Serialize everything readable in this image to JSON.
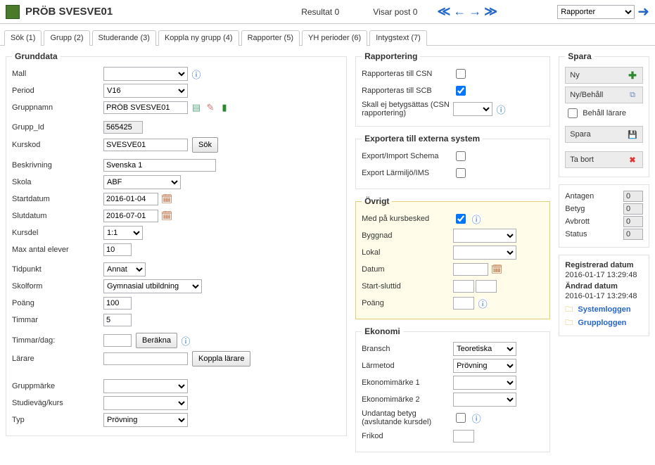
{
  "header": {
    "title": "PRÖB SVESVE01",
    "result_label": "Resultat",
    "result_value": "0",
    "post_label": "Visar post",
    "post_value": "0",
    "report_select": "Rapporter"
  },
  "tabs": [
    {
      "label": "Sök (1)"
    },
    {
      "label": "Grupp (2)"
    },
    {
      "label": "Studerande (3)"
    },
    {
      "label": "Koppla ny grupp (4)"
    },
    {
      "label": "Rapporter (5)"
    },
    {
      "label": "YH perioder (6)"
    },
    {
      "label": "Intygstext (7)"
    }
  ],
  "grunddata": {
    "legend": "Grunddata",
    "mall_label": "Mall",
    "mall": "",
    "period_label": "Period",
    "period": "V16",
    "gruppnamn_label": "Gruppnamn",
    "gruppnamn": "PRÖB SVESVE01",
    "gruppid_label": "Grupp_Id",
    "gruppid": "565425",
    "kurskod_label": "Kurskod",
    "kurskod": "SVESVE01",
    "sok_btn": "Sök",
    "beskrivning_label": "Beskrivning",
    "beskrivning": "Svenska 1",
    "skola_label": "Skola",
    "skola": "ABF",
    "startdatum_label": "Startdatum",
    "startdatum": "2016-01-04",
    "slutdatum_label": "Slutdatum",
    "slutdatum": "2016-07-01",
    "kursdel_label": "Kursdel",
    "kursdel": "1:1",
    "maxelever_label": "Max antal elever",
    "maxelever": "10",
    "tidpunkt_label": "Tidpunkt",
    "tidpunkt": "Annat",
    "skolform_label": "Skolform",
    "skolform": "Gymnasial utbildning",
    "poang_label": "Poäng",
    "poang": "100",
    "timmar_label": "Timmar",
    "timmar": "5",
    "timmardag_label": "Timmar/dag:",
    "timmardag": "",
    "berakna_btn": "Beräkna",
    "larare_label": "Lärare",
    "larare": "",
    "koppla_larare_btn": "Koppla lärare",
    "gruppmarke_label": "Gruppmärke",
    "studievag_label": "Studieväg/kurs",
    "typ_label": "Typ",
    "typ": "Prövning"
  },
  "rapportering": {
    "legend": "Rapportering",
    "csn_label": "Rapporteras till CSN",
    "csn": false,
    "scb_label": "Rapporteras till SCB",
    "scb": true,
    "skallej_label": "Skall ej betygsättas (CSN rapportering)",
    "skallej": ""
  },
  "export": {
    "legend": "Exportera till externa system",
    "schema_label": "Export/Import Schema",
    "schema": false,
    "ims_label": "Export Lärmiljö/IMS",
    "ims": false
  },
  "ovrigt": {
    "legend": "Övrigt",
    "medpa_label": "Med på kursbesked",
    "medpa": true,
    "byggnad_label": "Byggnad",
    "lokal_label": "Lokal",
    "datum_label": "Datum",
    "datum": "",
    "startsluttid_label": "Start-sluttid",
    "st1": "",
    "st2": "",
    "poang_label": "Poäng",
    "poang": ""
  },
  "ekonomi": {
    "legend": "Ekonomi",
    "bransch_label": "Bransch",
    "bransch": "Teoretiska",
    "larmetod_label": "Lärmetod",
    "larmetod": "Prövning",
    "eko1_label": "Ekonomimärke 1",
    "eko2_label": "Ekonomimärke 2",
    "undantag_label": "Undantag betyg (avslutande kursdel)",
    "undantag": false,
    "frikod_label": "Frikod"
  },
  "sidebar": {
    "spara_legend": "Spara",
    "ny": "Ny",
    "nybehall": "Ny/Behåll",
    "behall_larare": "Behåll lärare",
    "spara": "Spara",
    "tabort": "Ta bort",
    "antagen_label": "Antagen",
    "antagen": "0",
    "betyg_label": "Betyg",
    "betyg": "0",
    "avbrott_label": "Avbrott",
    "avbrott": "0",
    "status_label": "Status",
    "status": "0",
    "reg_label": "Registrerad datum",
    "reg_date": "2016-01-17 13:29:48",
    "chg_label": "Ändrad datum",
    "chg_date": "2016-01-17 13:29:48",
    "syslog": "Systemloggen",
    "grplog": "Grupploggen"
  }
}
